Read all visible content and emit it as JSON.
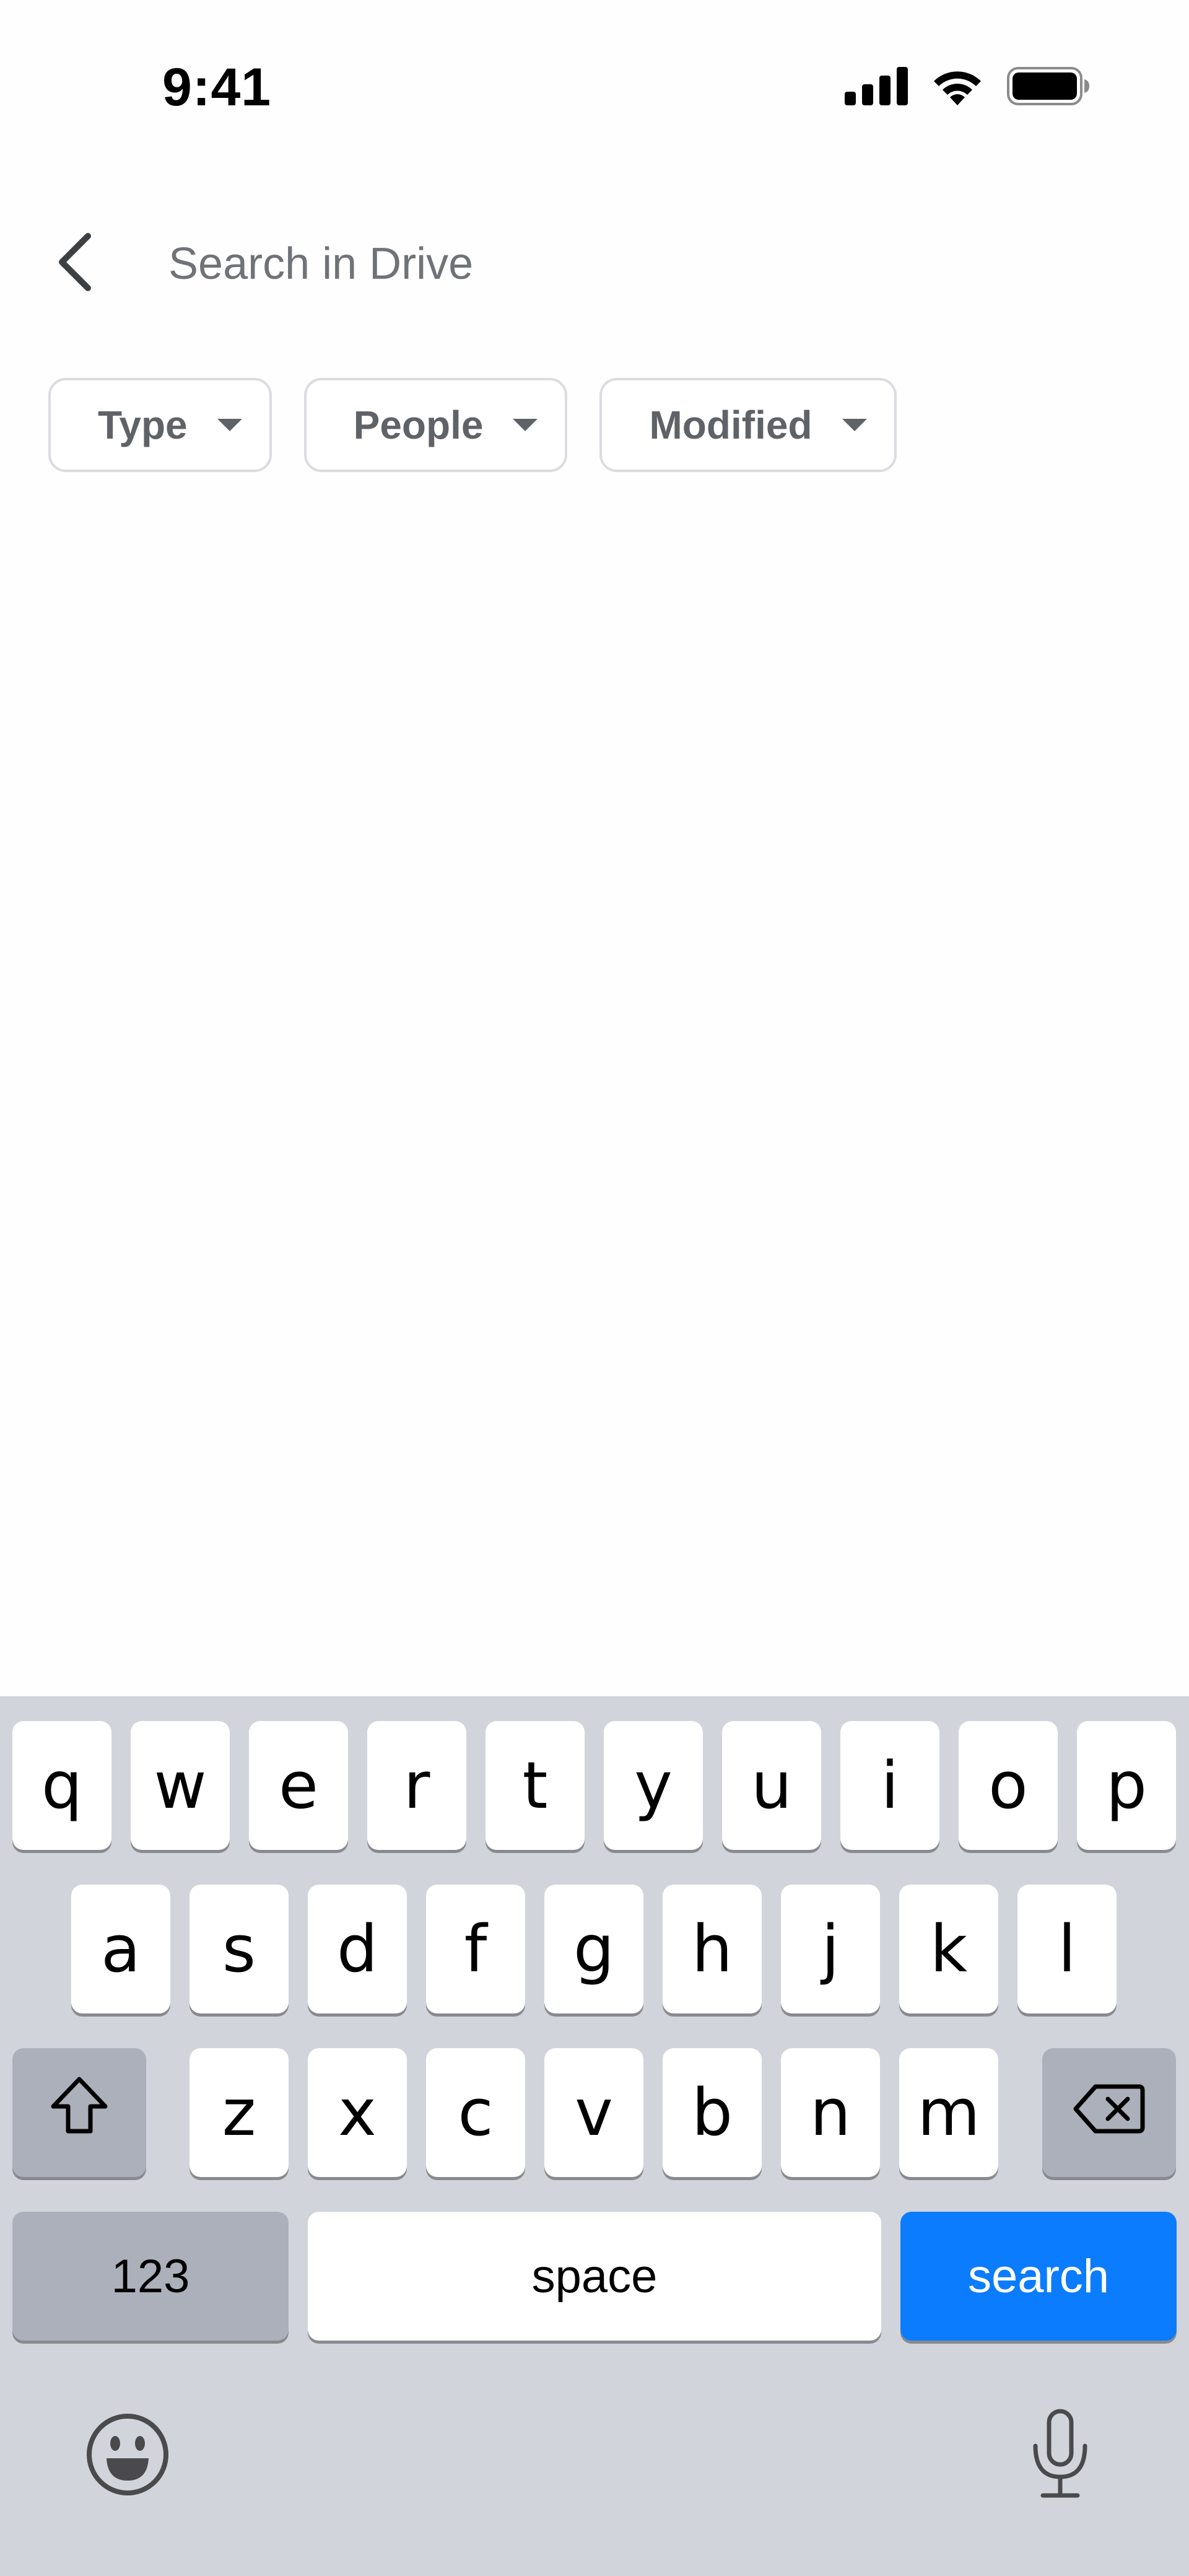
{
  "status_bar": {
    "time": "9:41",
    "icons": [
      "cellular-signal-icon",
      "wifi-icon",
      "battery-icon"
    ]
  },
  "search": {
    "placeholder": "Search in Drive",
    "value": ""
  },
  "filters": [
    {
      "label": "Type"
    },
    {
      "label": "People"
    },
    {
      "label": "Modified"
    }
  ],
  "keyboard": {
    "row1": [
      "q",
      "w",
      "e",
      "r",
      "t",
      "y",
      "u",
      "i",
      "o",
      "p"
    ],
    "row2": [
      "a",
      "s",
      "d",
      "f",
      "g",
      "h",
      "j",
      "k",
      "l"
    ],
    "row3": [
      "z",
      "x",
      "c",
      "v",
      "b",
      "n",
      "m"
    ],
    "numbers_label": "123",
    "space_label": "space",
    "search_label": "search",
    "colors": {
      "background": "#d2d4dc",
      "key": "#ffffff",
      "modifier_key": "#abb0ba",
      "search_key": "#0b7cfd"
    }
  }
}
